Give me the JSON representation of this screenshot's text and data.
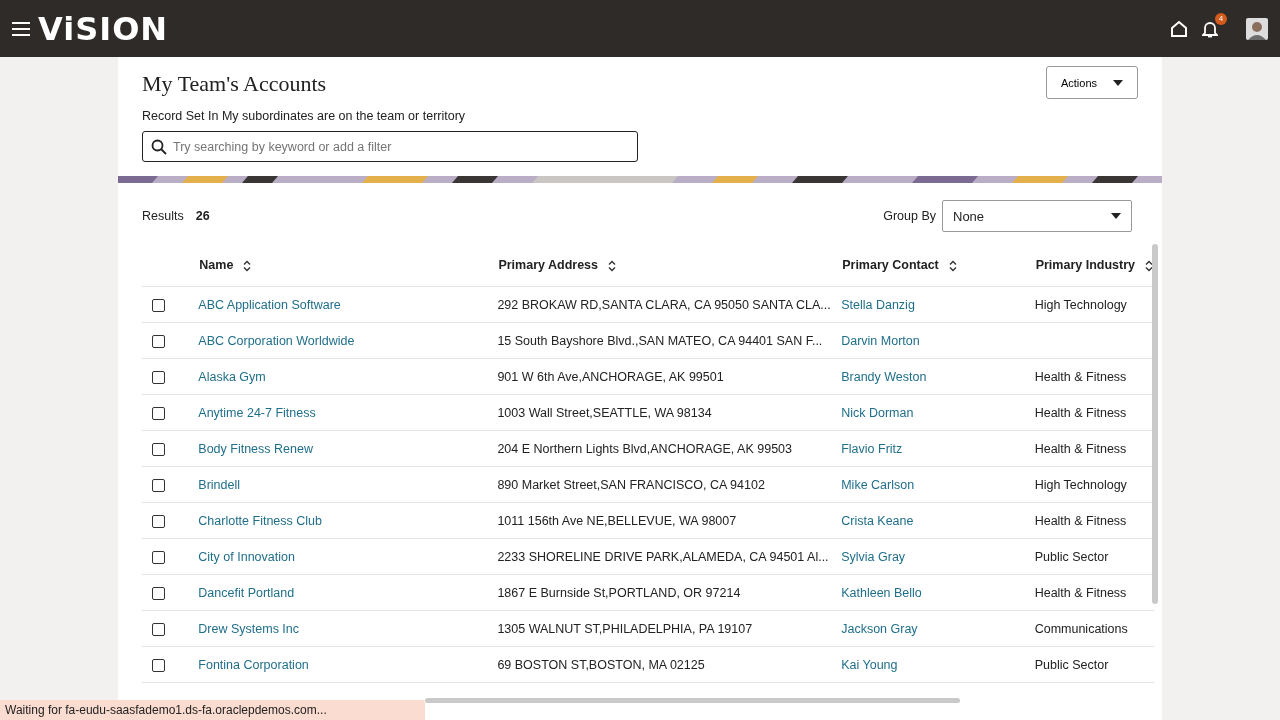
{
  "header": {
    "logo": "ViSION",
    "notifications": "4"
  },
  "page": {
    "title": "My Team's Accounts",
    "record_set": "Record Set In My subordinates are on the team or territory",
    "search": {
      "placeholder": "Try searching by keyword or add a filter"
    },
    "actions": "Actions"
  },
  "results": {
    "label": "Results",
    "count": "26"
  },
  "group_by": {
    "label": "Group By",
    "value": "None"
  },
  "table": {
    "columns": [
      "Name",
      "Primary Address",
      "Primary Contact",
      "Primary Industry"
    ],
    "rows": [
      {
        "checked": false,
        "name": "ABC Application Software",
        "address": "292 BROKAW RD,SANTA CLARA, CA 95050 SANTA CLA...",
        "contact": "Stella Danzig",
        "industry": "High Technology"
      },
      {
        "checked": false,
        "name": "ABC Corporation Worldwide",
        "address": "15 South Bayshore Blvd.,SAN MATEO, CA 94401 SAN F...",
        "contact": "Darvin Morton"
      },
      {
        "checked": false,
        "name": "Alaska Gym",
        "address": "901 W 6th Ave,ANCHORAGE, AK 99501",
        "contact": "Brandy Weston",
        "industry": "Health & Fitness"
      },
      {
        "checked": false,
        "name": "Anytime 24-7 Fitness",
        "address": "1003 Wall Street,SEATTLE, WA 98134",
        "contact": "Nick Dorman",
        "industry": "Health & Fitness"
      },
      {
        "checked": false,
        "name": "Body Fitness Renew",
        "address": "204 E Northern Lights Blvd,ANCHORAGE, AK 99503",
        "contact": "Flavio Fritz",
        "industry": "Health & Fitness"
      },
      {
        "checked": false,
        "name": "Brindell",
        "address": "890 Market Street,SAN FRANCISCO, CA 94102",
        "contact": "Mike Carlson",
        "industry": "High Technology"
      },
      {
        "checked": false,
        "name": "Charlotte Fitness Club",
        "address": "1011 156th Ave NE,BELLEVUE, WA 98007",
        "contact": "Crista Keane",
        "industry": "Health & Fitness"
      },
      {
        "checked": false,
        "name": "City of Innovation",
        "address": "2233 SHORELINE DRIVE PARK,ALAMEDA, CA 94501 Al...",
        "contact": "Sylvia Gray",
        "industry": "Public Sector"
      },
      {
        "checked": false,
        "name": "Dancefit Portland",
        "address": "1867 E Burnside St,PORTLAND, OR 97214",
        "contact": "Kathleen Bello",
        "industry": "Health & Fitness"
      },
      {
        "checked": false,
        "name": "Drew Systems Inc",
        "address": "1305 WALNUT ST,PHILADELPHIA, PA 19107",
        "contact": "Jackson Gray",
        "industry": "Communications"
      },
      {
        "checked": false,
        "name": "Fontina Corporation",
        "address": "69 BOSTON ST,BOSTON, MA 02125",
        "contact": "Kai Young",
        "industry": "Public Sector"
      }
    ]
  },
  "status_bar": "Waiting for fa-eudu-saasfademo1.ds-fa.oraclepdemos.com..."
}
